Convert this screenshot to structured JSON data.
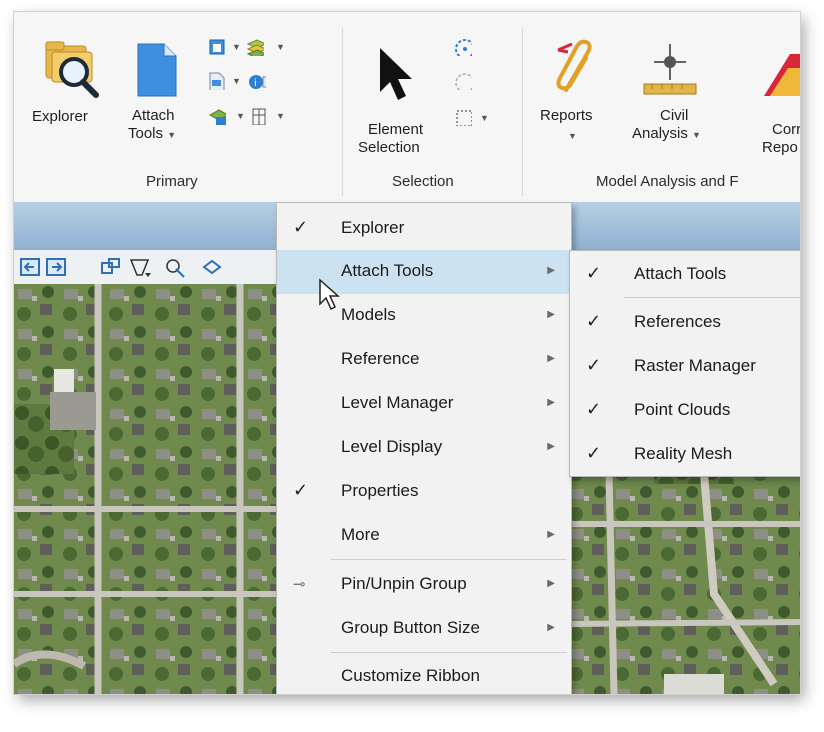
{
  "ribbon": {
    "groups": {
      "primary": "Primary",
      "selection": "Selection",
      "model_analysis": "Model Analysis and F"
    },
    "buttons": {
      "explorer": "Explorer",
      "attach_tools_line1": "Attach",
      "attach_tools_line2": "Tools",
      "element_selection_line1": "Element",
      "element_selection_line2": "Selection",
      "reports": "Reports",
      "civil_analysis_line1": "Civil",
      "civil_analysis_line2": "Analysis",
      "corr_report_line1": "Corr",
      "corr_report_line2": "Repo"
    },
    "icons": {
      "explorer": "folder-search-icon",
      "attach_tools": "document-icon",
      "element_selection": "arrow-pointer-icon",
      "reports": "paperclip-icon",
      "civil_analysis": "target-ruler-icon"
    }
  },
  "context_menu": {
    "items": [
      {
        "label": "Explorer",
        "checked": true,
        "submenu": false
      },
      {
        "label": "Attach Tools",
        "checked": false,
        "submenu": true,
        "highlighted": true
      },
      {
        "label": "Models",
        "checked": false,
        "submenu": true
      },
      {
        "label": "Reference",
        "checked": false,
        "submenu": true
      },
      {
        "label": "Level Manager",
        "checked": false,
        "submenu": true
      },
      {
        "label": "Level Display",
        "checked": false,
        "submenu": true
      },
      {
        "label": "Properties",
        "checked": true,
        "submenu": false
      },
      {
        "label": "More",
        "checked": false,
        "submenu": true
      },
      {
        "label": "Pin/Unpin Group",
        "checked": false,
        "submenu": true,
        "icon": "pin-icon"
      },
      {
        "label": "Group Button Size",
        "checked": false,
        "submenu": true
      },
      {
        "label": "Customize Ribbon",
        "checked": false,
        "submenu": false
      }
    ]
  },
  "submenu": {
    "items": [
      {
        "label": "Attach Tools",
        "checked": true
      },
      {
        "label": "References",
        "checked": true
      },
      {
        "label": "Raster Manager",
        "checked": true
      },
      {
        "label": "Point Clouds",
        "checked": true
      },
      {
        "label": "Reality Mesh",
        "checked": true
      }
    ]
  },
  "glyphs": {
    "check": "✓",
    "submenu_arrow": "▶",
    "dropdown": "▼",
    "pin": "⊸"
  },
  "colors": {
    "highlight": "#cde2f1",
    "titlebar": "#9fbcd8",
    "menu_bg": "#f2f2f2"
  }
}
